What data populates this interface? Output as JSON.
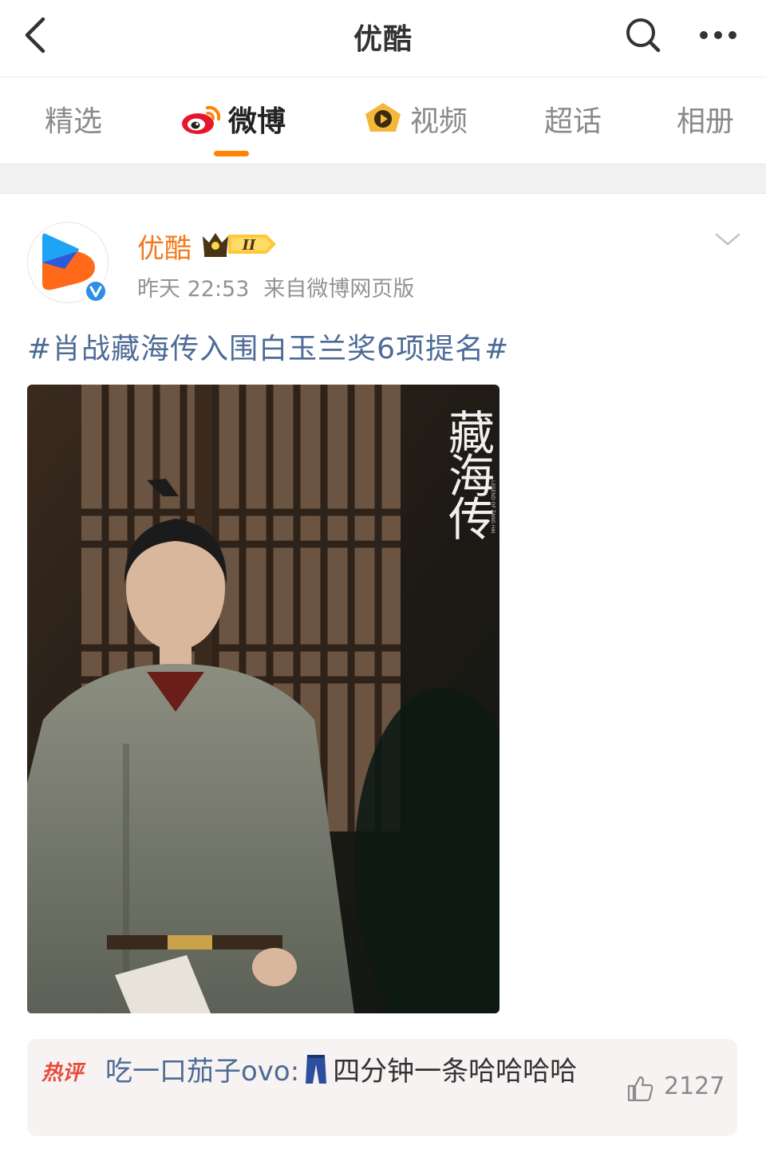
{
  "header": {
    "title": "优酷"
  },
  "tabs": [
    {
      "label": "精选",
      "active": false
    },
    {
      "label": "微博",
      "active": true,
      "icon": "weibo-logo-icon"
    },
    {
      "label": "视频",
      "active": false,
      "icon": "video-play-icon"
    },
    {
      "label": "超话",
      "active": false
    },
    {
      "label": "相册",
      "active": false
    }
  ],
  "colors": {
    "accent": "#ff8200",
    "username": "#f2791d",
    "link": "#4d6b96",
    "hot": "#e84a3c"
  },
  "post": {
    "author": "优酷",
    "vip_level": "II",
    "time": "昨天 22:53",
    "source": "来自微博网页版",
    "hashtag": "#肖战藏海传入围白玉兰奖6项提名#",
    "image": {
      "title": "藏海传",
      "subtitle": "LEGEND OF ZANG HAI"
    }
  },
  "hot_comment": {
    "label": "热评",
    "user": "吃一口茄子ovo:",
    "emoji": "jeans-icon",
    "text": "四分钟一条哈哈哈哈",
    "likes": "2127"
  }
}
